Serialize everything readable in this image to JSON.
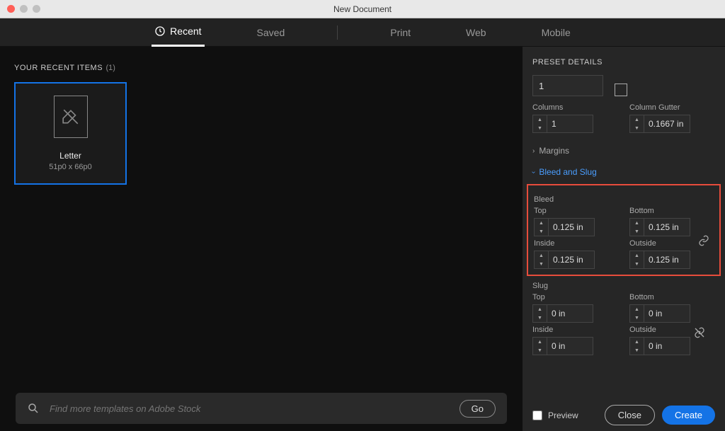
{
  "window": {
    "title": "New Document"
  },
  "tabs": {
    "recent": "Recent",
    "saved": "Saved",
    "print": "Print",
    "web": "Web",
    "mobile": "Mobile"
  },
  "leftPanel": {
    "header": "YOUR RECENT ITEMS",
    "count": "(1)",
    "preset": {
      "name": "Letter",
      "dimensions": "51p0 x 66p0"
    },
    "search": {
      "placeholder": "Find more templates on Adobe Stock",
      "goLabel": "Go"
    }
  },
  "rightPanel": {
    "header": "PRESET DETAILS",
    "nameValue": "1",
    "columns": {
      "label": "Columns",
      "value": "1"
    },
    "gutter": {
      "label": "Column Gutter",
      "value": "0.1667 in"
    },
    "marginsLabel": "Margins",
    "bleedSlugLabel": "Bleed and Slug",
    "bleed": {
      "label": "Bleed",
      "top": {
        "label": "Top",
        "value": "0.125 in"
      },
      "bottom": {
        "label": "Bottom",
        "value": "0.125 in"
      },
      "inside": {
        "label": "Inside",
        "value": "0.125 in"
      },
      "outside": {
        "label": "Outside",
        "value": "0.125 in"
      }
    },
    "slug": {
      "label": "Slug",
      "top": {
        "label": "Top",
        "value": "0 in"
      },
      "bottom": {
        "label": "Bottom",
        "value": "0 in"
      },
      "inside": {
        "label": "Inside",
        "value": "0 in"
      },
      "outside": {
        "label": "Outside",
        "value": "0 in"
      }
    },
    "preview": "Preview",
    "close": "Close",
    "create": "Create"
  }
}
